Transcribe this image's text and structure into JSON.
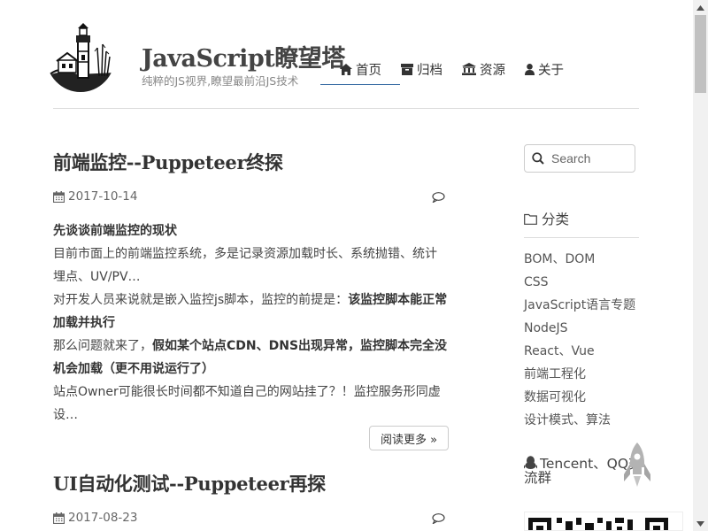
{
  "site": {
    "title": "JavaScript瞭望塔",
    "subtitle": "纯粹的JS视界,瞭望最前沿JS技术"
  },
  "nav": {
    "items": [
      {
        "label": "首页",
        "icon": "home-icon"
      },
      {
        "label": "归档",
        "icon": "archive-icon"
      },
      {
        "label": "资源",
        "icon": "bank-icon"
      },
      {
        "label": "关于",
        "icon": "user-icon"
      }
    ],
    "active_index": 0
  },
  "posts": [
    {
      "title": "前端监控--Puppeteer终探",
      "date": "2017-10-14",
      "excerpt": {
        "heading": "先谈谈前端监控的现状",
        "p1": "目前市面上的前端监控系统，多是记录资源加载时长、系统抛错、统计埋点、UV/PV…",
        "p2_plain": "对开发人员来说就是嵌入监控js脚本，监控的前提是：",
        "p2_bold": "该监控脚本能正常加载并执行",
        "p3_plain": "那么问题就来了，",
        "p3_bold": "假如某个站点CDN、DNS出现异常，监控脚本完全没机会加载（更不用说运行了）",
        "p4": "站点Owner可能很长时间都不知道自己的网站挂了？！监控服务形同虚设…"
      },
      "read_more": "阅读更多 »"
    },
    {
      "title": "UI自动化测试--Puppeteer再探",
      "date": "2017-08-23"
    }
  ],
  "sidebar": {
    "search_placeholder": "Search",
    "categories_title": "分类",
    "categories": [
      "BOM、DOM",
      "CSS",
      "JavaScript语言专题",
      "NodeJS",
      "React、Vue",
      "前端工程化",
      "数据可视化",
      "设计模式、算法"
    ],
    "qq_title": "Tencent、QQ交流群"
  }
}
